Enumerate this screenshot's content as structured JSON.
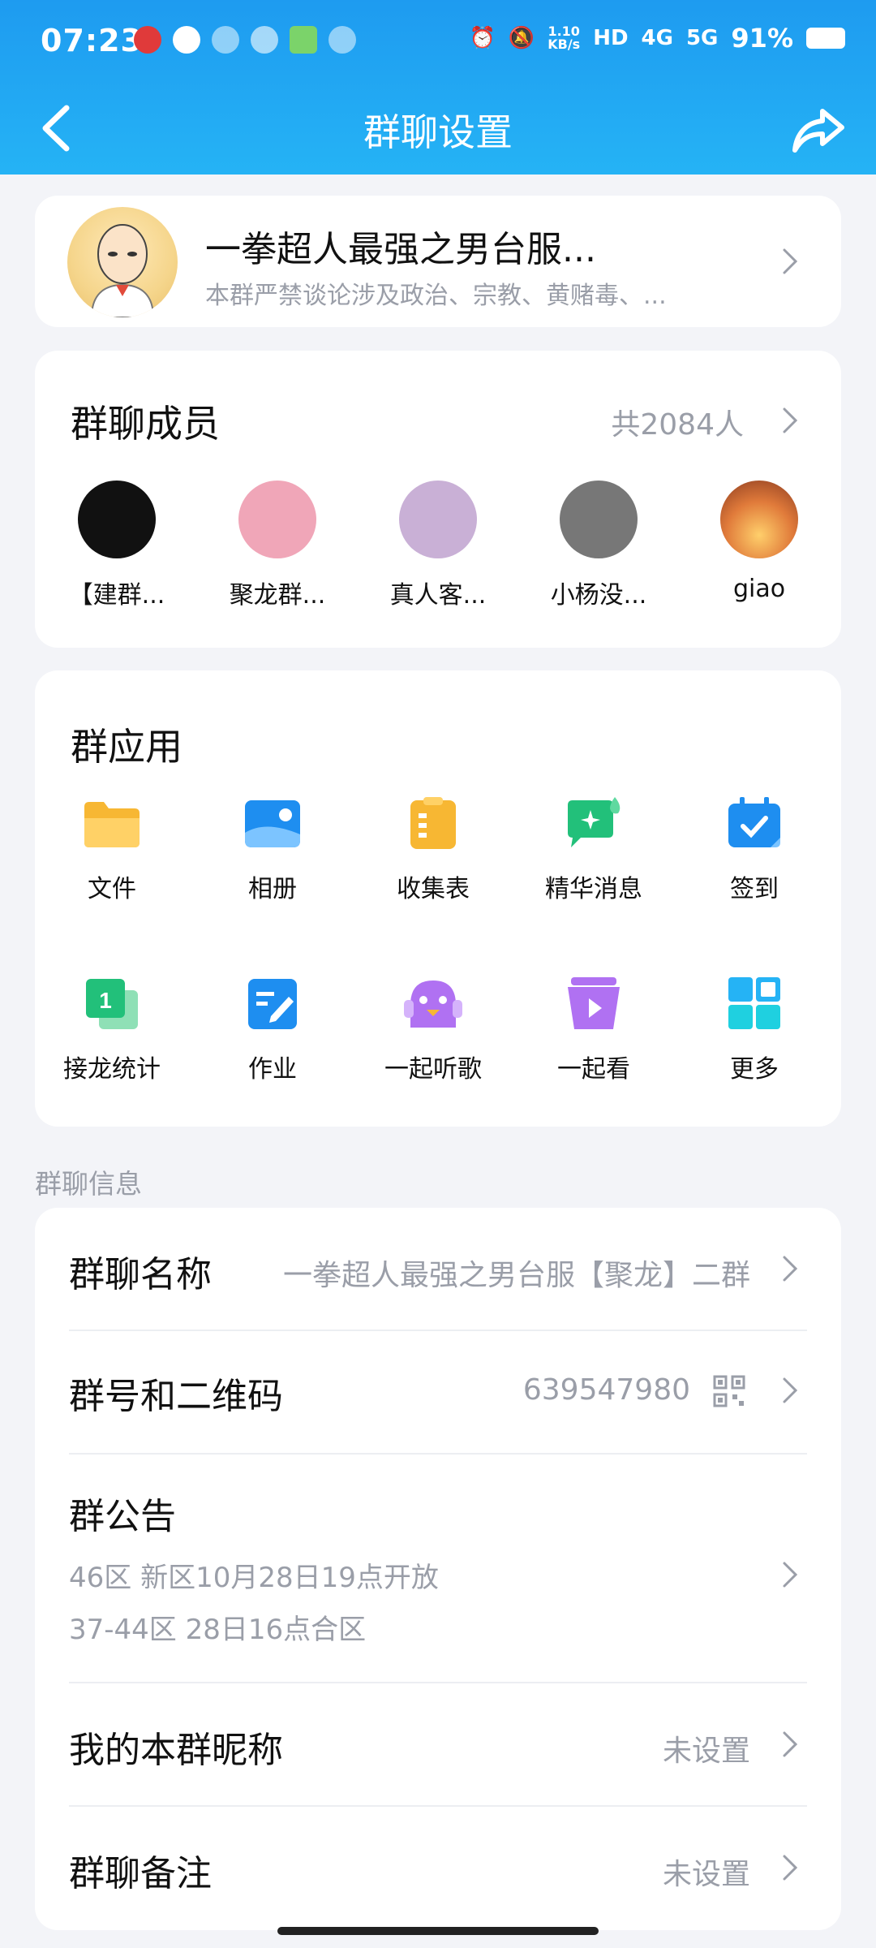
{
  "status_bar": {
    "time": "07:23",
    "network_speed": "1.10\nKB/s",
    "signal_labels": [
      "HD",
      "4G",
      "5G"
    ],
    "battery": "91%"
  },
  "nav": {
    "title": "群聊设置"
  },
  "group": {
    "name": "一拳超人最强之男台服...",
    "description": "本群严禁谈论涉及政治、宗教、黄赌毒、..."
  },
  "members": {
    "title": "群聊成员",
    "count": "共2084人",
    "items": [
      {
        "name": "【建群...",
        "color": "#111111"
      },
      {
        "name": "聚龙群...",
        "color": "#f0a6b8"
      },
      {
        "name": "真人客...",
        "color": "#c9b0d6"
      },
      {
        "name": "小杨没...",
        "color": "#777777"
      },
      {
        "name": "giao",
        "color": "#e07a3a"
      }
    ]
  },
  "apps": {
    "title": "群应用",
    "items": [
      {
        "label": "文件",
        "icon": "folder-icon"
      },
      {
        "label": "相册",
        "icon": "album-icon"
      },
      {
        "label": "收集表",
        "icon": "clipboard-icon"
      },
      {
        "label": "精华消息",
        "icon": "essence-message-icon"
      },
      {
        "label": "签到",
        "icon": "calendar-check-icon"
      },
      {
        "label": "接龙统计",
        "icon": "relay-stat-icon"
      },
      {
        "label": "作业",
        "icon": "homework-icon"
      },
      {
        "label": "一起听歌",
        "icon": "listen-together-icon"
      },
      {
        "label": "一起看",
        "icon": "watch-together-icon"
      },
      {
        "label": "更多",
        "icon": "more-grid-icon"
      }
    ]
  },
  "info": {
    "section_label": "群聊信息",
    "group_name_label": "群聊名称",
    "group_name_value": "一拳超人最强之男台服【聚龙】二群",
    "group_id_label": "群号和二维码",
    "group_id_value": "639547980",
    "notice_label": "群公告",
    "notice_lines": [
      "46区 新区10月28日19点开放",
      "37-44区 28日16点合区"
    ],
    "nickname_label": "我的本群昵称",
    "nickname_value": "未设置",
    "remark_label": "群聊备注",
    "remark_value": "未设置"
  },
  "colors": {
    "header_start": "#1e9bf0",
    "header_end": "#25b3f5",
    "page_bg": "#f3f4f8",
    "secondary_text": "#9a9ea8"
  }
}
